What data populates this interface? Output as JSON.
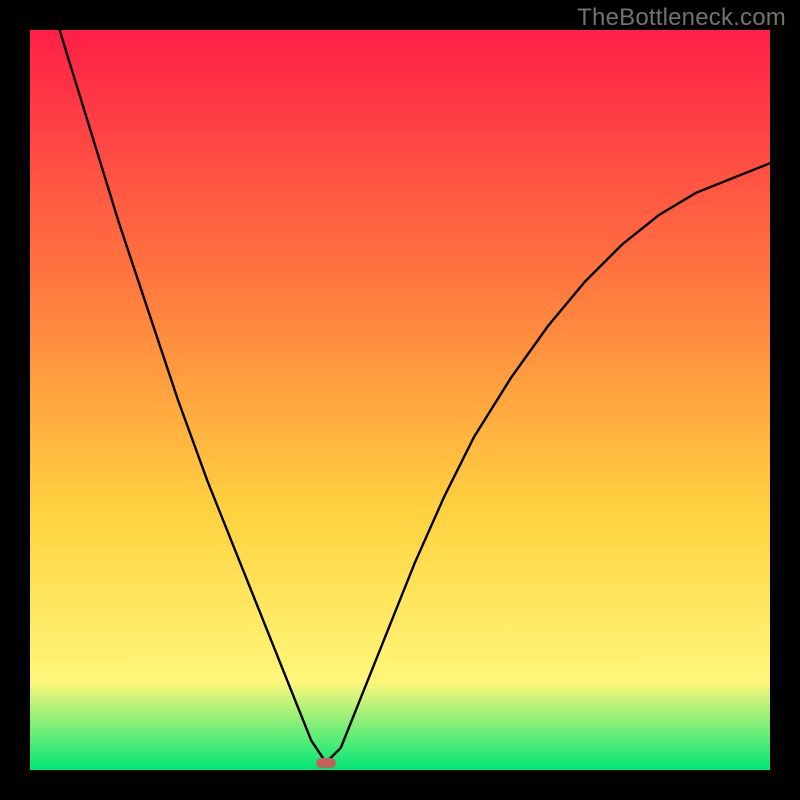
{
  "watermark": "TheBottleneck.com",
  "chart_data": {
    "type": "line",
    "title": "",
    "xlabel": "",
    "ylabel": "",
    "xlim": [
      0,
      100
    ],
    "ylim": [
      0,
      100
    ],
    "gradient": {
      "top": "#ff1f47",
      "mid_high": "#ff7a3f",
      "mid": "#ffd23f",
      "mid_low": "#fff67a",
      "bottom": "#00e676"
    },
    "curve_color": "#000000",
    "marker_color": "#c1635a",
    "minimum_x": 40,
    "series": [
      {
        "name": "bottleneck-curve",
        "points": [
          {
            "x": 4,
            "y": 100
          },
          {
            "x": 8,
            "y": 87
          },
          {
            "x": 12,
            "y": 74
          },
          {
            "x": 16,
            "y": 62
          },
          {
            "x": 20,
            "y": 50
          },
          {
            "x": 24,
            "y": 39
          },
          {
            "x": 28,
            "y": 29
          },
          {
            "x": 32,
            "y": 19
          },
          {
            "x": 36,
            "y": 9
          },
          {
            "x": 38,
            "y": 4
          },
          {
            "x": 40,
            "y": 1
          },
          {
            "x": 42,
            "y": 3
          },
          {
            "x": 44,
            "y": 8
          },
          {
            "x": 48,
            "y": 18
          },
          {
            "x": 52,
            "y": 28
          },
          {
            "x": 56,
            "y": 37
          },
          {
            "x": 60,
            "y": 45
          },
          {
            "x": 65,
            "y": 53
          },
          {
            "x": 70,
            "y": 60
          },
          {
            "x": 75,
            "y": 66
          },
          {
            "x": 80,
            "y": 71
          },
          {
            "x": 85,
            "y": 75
          },
          {
            "x": 90,
            "y": 78
          },
          {
            "x": 95,
            "y": 80
          },
          {
            "x": 100,
            "y": 82
          }
        ]
      }
    ]
  }
}
